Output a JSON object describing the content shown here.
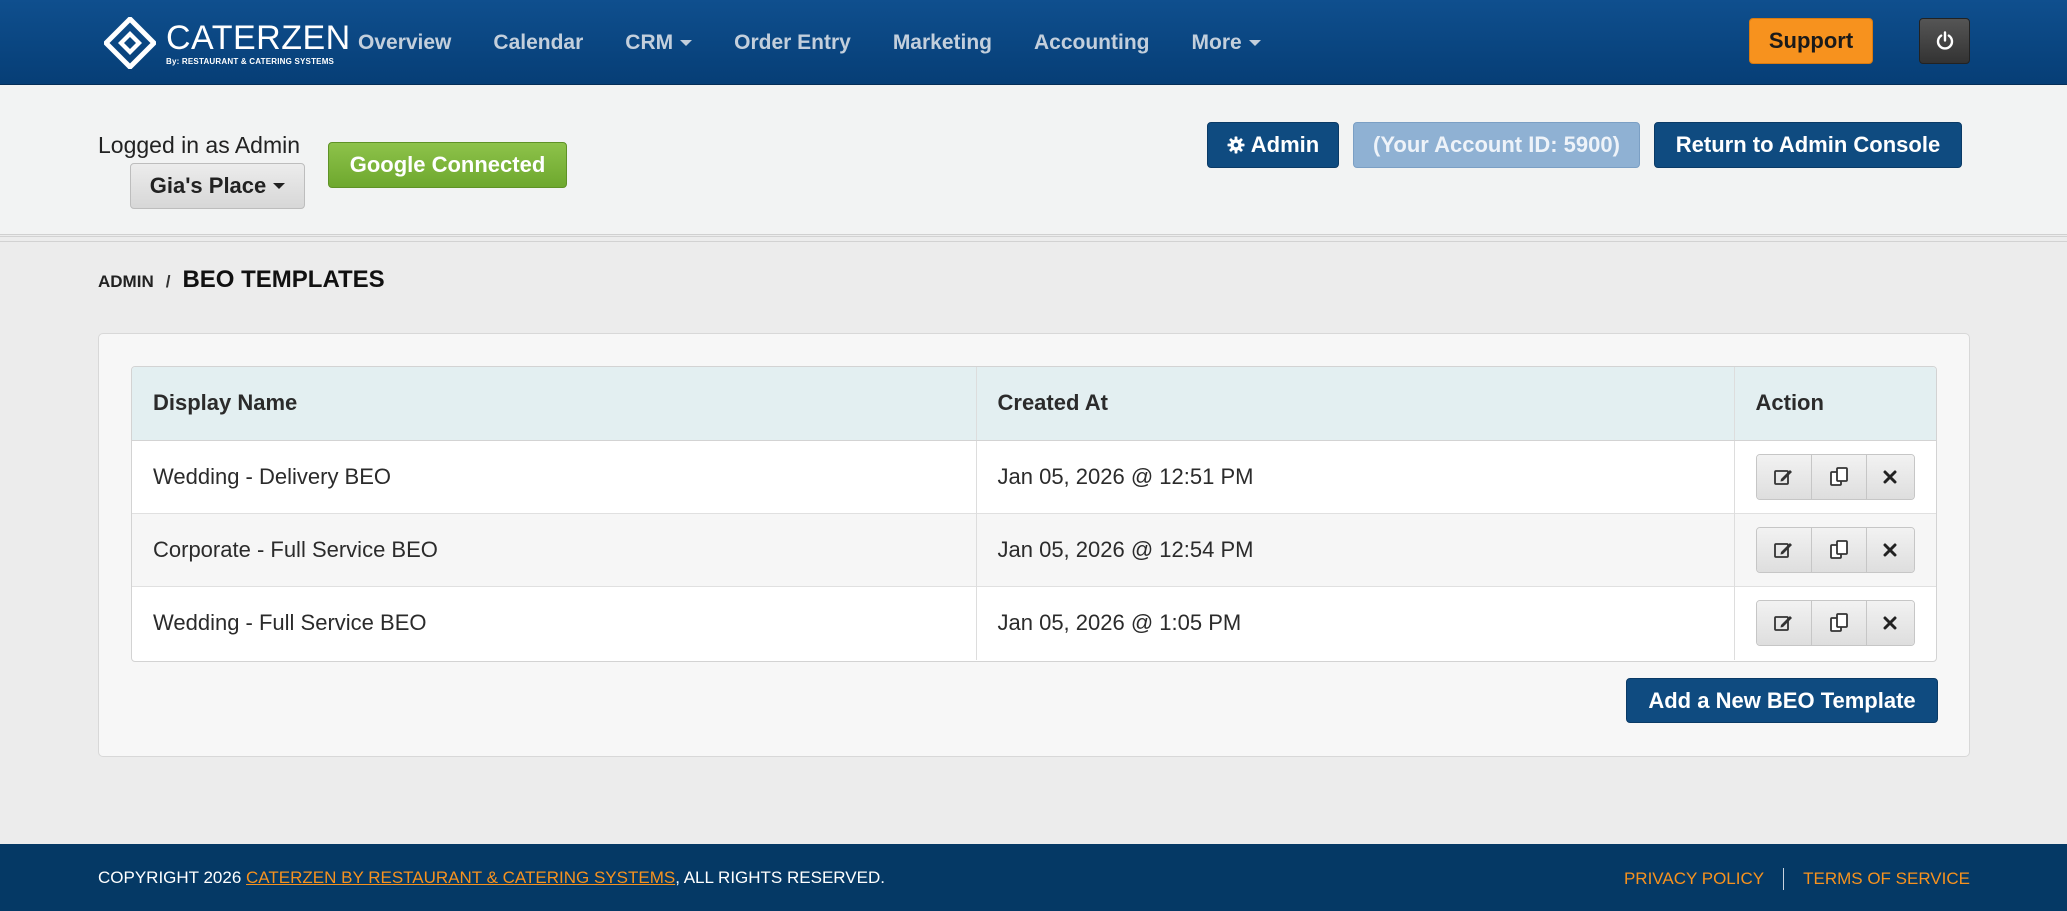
{
  "brand": {
    "name": "CATERZEN",
    "tagline": "By: RESTAURANT & CATERING SYSTEMS"
  },
  "nav": {
    "items": [
      {
        "label": "Overview",
        "dropdown": false
      },
      {
        "label": "Calendar",
        "dropdown": false
      },
      {
        "label": "CRM",
        "dropdown": true
      },
      {
        "label": "Order Entry",
        "dropdown": false
      },
      {
        "label": "Marketing",
        "dropdown": false
      },
      {
        "label": "Accounting",
        "dropdown": false
      },
      {
        "label": "More",
        "dropdown": true
      }
    ],
    "support_label": "Support",
    "power_icon": "power-icon"
  },
  "subheader": {
    "logged_in_text": "Logged in as Admin",
    "account_name": "Gia's Place",
    "google_status": "Google Connected",
    "admin_label": "Admin",
    "account_id_label": "(Your Account ID: 5900)",
    "return_label": "Return to Admin Console"
  },
  "breadcrumb": {
    "parent": "ADMIN",
    "separator": "/",
    "current": "BEO TEMPLATES"
  },
  "table": {
    "headers": [
      "Display Name",
      "Created At",
      "Action"
    ],
    "rows": [
      {
        "name": "Wedding - Delivery BEO",
        "created": "Jan 05, 2026 @ 12:51 PM"
      },
      {
        "name": "Corporate - Full Service BEO",
        "created": "Jan 05, 2026 @ 12:54 PM"
      },
      {
        "name": "Wedding - Full Service BEO",
        "created": "Jan 05, 2026 @ 1:05 PM"
      }
    ],
    "action_icons": [
      "edit-icon",
      "copy-icon",
      "delete-icon"
    ]
  },
  "add_button_label": "Add a New BEO Template",
  "footer": {
    "copyright_prefix": "COPYRIGHT 2026 ",
    "copyright_link": "CATERZEN BY RESTAURANT & CATERING SYSTEMS",
    "copyright_suffix": ", ALL RIGHTS RESERVED.",
    "privacy": "PRIVACY POLICY",
    "terms": "TERMS OF SERVICE"
  },
  "colors": {
    "navbar": "#0a4680",
    "accent_orange": "#f7921e",
    "primary_button": "#0f4b80",
    "google_green": "#7ab53a",
    "footer": "#053965"
  }
}
